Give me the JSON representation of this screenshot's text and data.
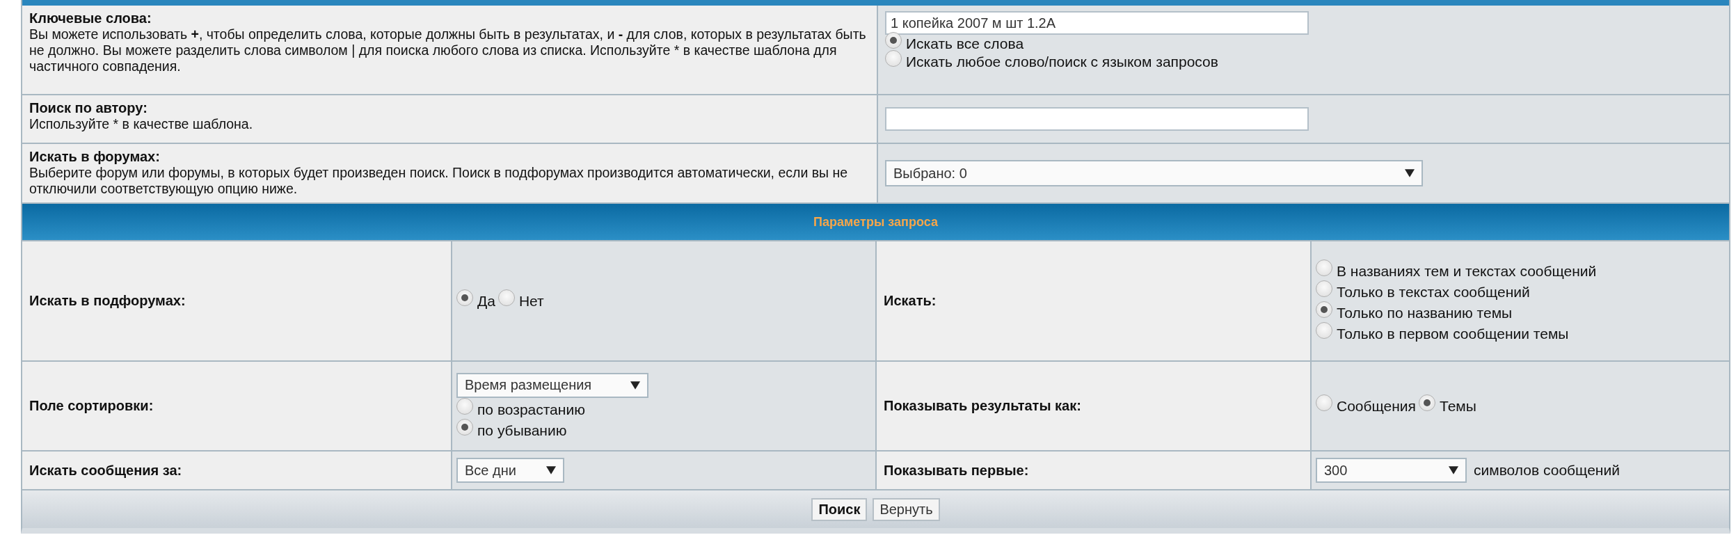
{
  "search_fields": [
    {
      "title": "Ключевые слова:",
      "description": "Вы можете использовать **+**, чтобы определить слова, которые должны быть в результатах, и **-** для слов, которых в результатах быть не должно. Вы можете разделить слова символом | для поиска любого слова из списка. Используйте * в качестве шаблона для частичного совпадения.",
      "control": {
        "kind": "text",
        "value": "1 копейка 2007 м  шт 1.2А",
        "options": [
          {
            "label": "Искать все слова",
            "selected": true
          },
          {
            "label": "Искать любое слово/поиск с языком запросов",
            "selected": false
          }
        ]
      }
    },
    {
      "title": "Поиск по автору:",
      "description": "Используйте * в качестве шаблона.",
      "control": {
        "kind": "text"
      }
    },
    {
      "title": "Искать в форумах:",
      "description": "Выберите форум или форумы, в которых будет произведен поиск. Поиск в подфорумах производится автоматически, если вы не отключили соответствующую опцию ниже.",
      "control": {
        "kind": "select",
        "value": "Выбрано: 0"
      }
    }
  ],
  "query_params": {
    "title": "Параметры запроса",
    "rows": [
      [
        {
          "label": "Искать в подфорумах:",
          "control": {
            "kind": "inline",
            "options": [
              {
                "label": "Да",
                "selected": true
              },
              {
                "label": "Нет",
                "selected": false
              }
            ]
          }
        },
        {
          "label": "Искать:",
          "control": {
            "kind": "stack",
            "options": [
              {
                "label": "В названиях тем и текстах сообщений",
                "selected": false
              },
              {
                "label": "Только в текстах сообщений",
                "selected": false
              },
              {
                "label": "Только по названию темы",
                "selected": true
              },
              {
                "label": "Только в первом сообщении темы",
                "selected": false
              }
            ]
          }
        }
      ],
      [
        {
          "label": "Поле сортировки:",
          "control": {
            "kind": "stack",
            "select": "Время размещения",
            "options": [
              {
                "label": "по возрастанию",
                "selected": false
              },
              {
                "label": "по убыванию",
                "selected": true
              }
            ]
          }
        },
        {
          "label": "Показывать результаты как:",
          "control": {
            "kind": "inline",
            "options": [
              {
                "label": "Сообщения",
                "selected": false
              },
              {
                "label": "Темы",
                "selected": true
              }
            ]
          }
        }
      ],
      [
        {
          "label": "Искать сообщения за:",
          "control": {
            "kind": "inline",
            "select": "Все дни"
          }
        },
        {
          "label": "Показывать первые:",
          "control": {
            "kind": "inline",
            "select": "300",
            "suffix": "символов сообщений"
          }
        }
      ]
    ]
  },
  "buttons": [
    {
      "label": "Поиск",
      "primary": true
    },
    {
      "label": "Вернуть",
      "primary": false
    }
  ]
}
